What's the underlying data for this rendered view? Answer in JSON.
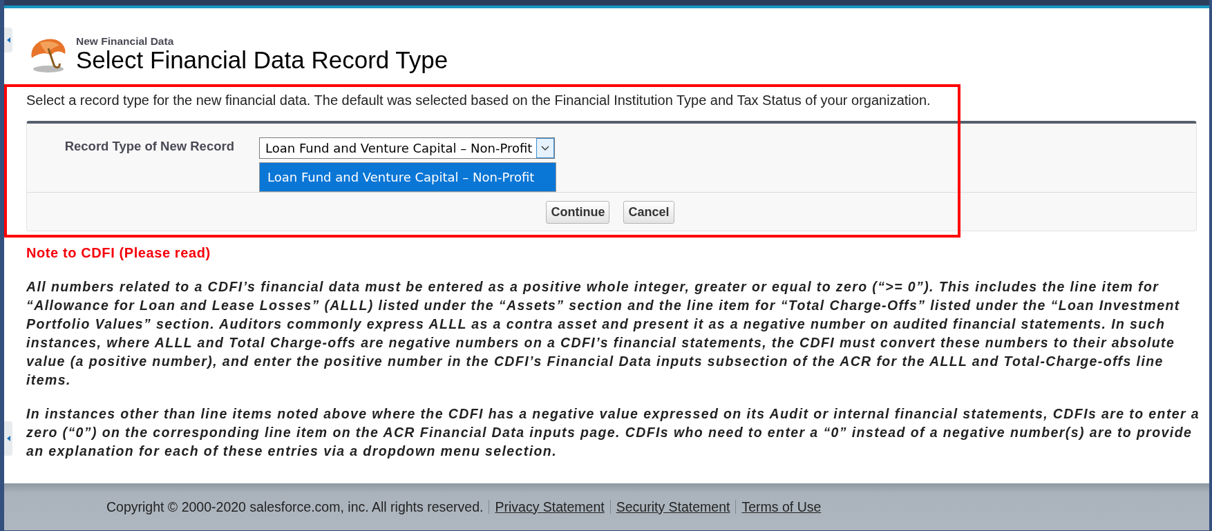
{
  "header": {
    "subtitle": "New Financial Data",
    "title": "Select Financial Data Record Type"
  },
  "instructions": "Select a record type for the new financial data. The default was selected based on the Financial Institution Type and Tax Status of your organization.",
  "record_type": {
    "label": "Record Type of New Record",
    "value": "Loan Fund and Venture Capital – Non-Profit",
    "expanded": true,
    "options": [
      {
        "label": "Loan Fund and Venture Capital – Non-Profit",
        "selected": true
      }
    ]
  },
  "buttons": [
    "Continue",
    "Cancel"
  ],
  "note": {
    "heading": "Note to CDFI (Please read)",
    "paragraphs": [
      "All numbers related to a CDFI’s financial data must be entered as a positive whole integer, greater or equal to zero (“>= 0”). This includes the line item for “Allowance for Loan and Lease Losses” (ALLL) listed under the “Assets” section and the line item for “Total Charge-Offs” listed under the “Loan Investment Portfolio Values” section. Auditors commonly express ALLL as a contra asset and present it as a negative number on audited financial statements. In such instances, where ALLL and Total Charge-offs are negative numbers on a CDFI’s financial statements, the CDFI must convert these numbers to their absolute value (a positive number), and enter the positive number in the CDFI’s Financial Data inputs subsection of the ACR for the ALLL and Total-Charge-offs line items.",
      "In instances other than line items noted above where the CDFI has a negative value expressed on its Audit or internal financial statements, CDFIs are to enter a zero (“0”) on the corresponding line item on the ACR Financial Data inputs page. CDFIs who need to enter a “0” instead of a negative number(s) are to provide an explanation for each of these entries via a dropdown menu selection."
    ]
  },
  "footer": {
    "copyright": "Copyright © 2000-2020 salesforce.com, inc. All rights reserved.",
    "links": [
      "Privacy Statement",
      "Security Statement",
      "Terms of Use"
    ]
  }
}
